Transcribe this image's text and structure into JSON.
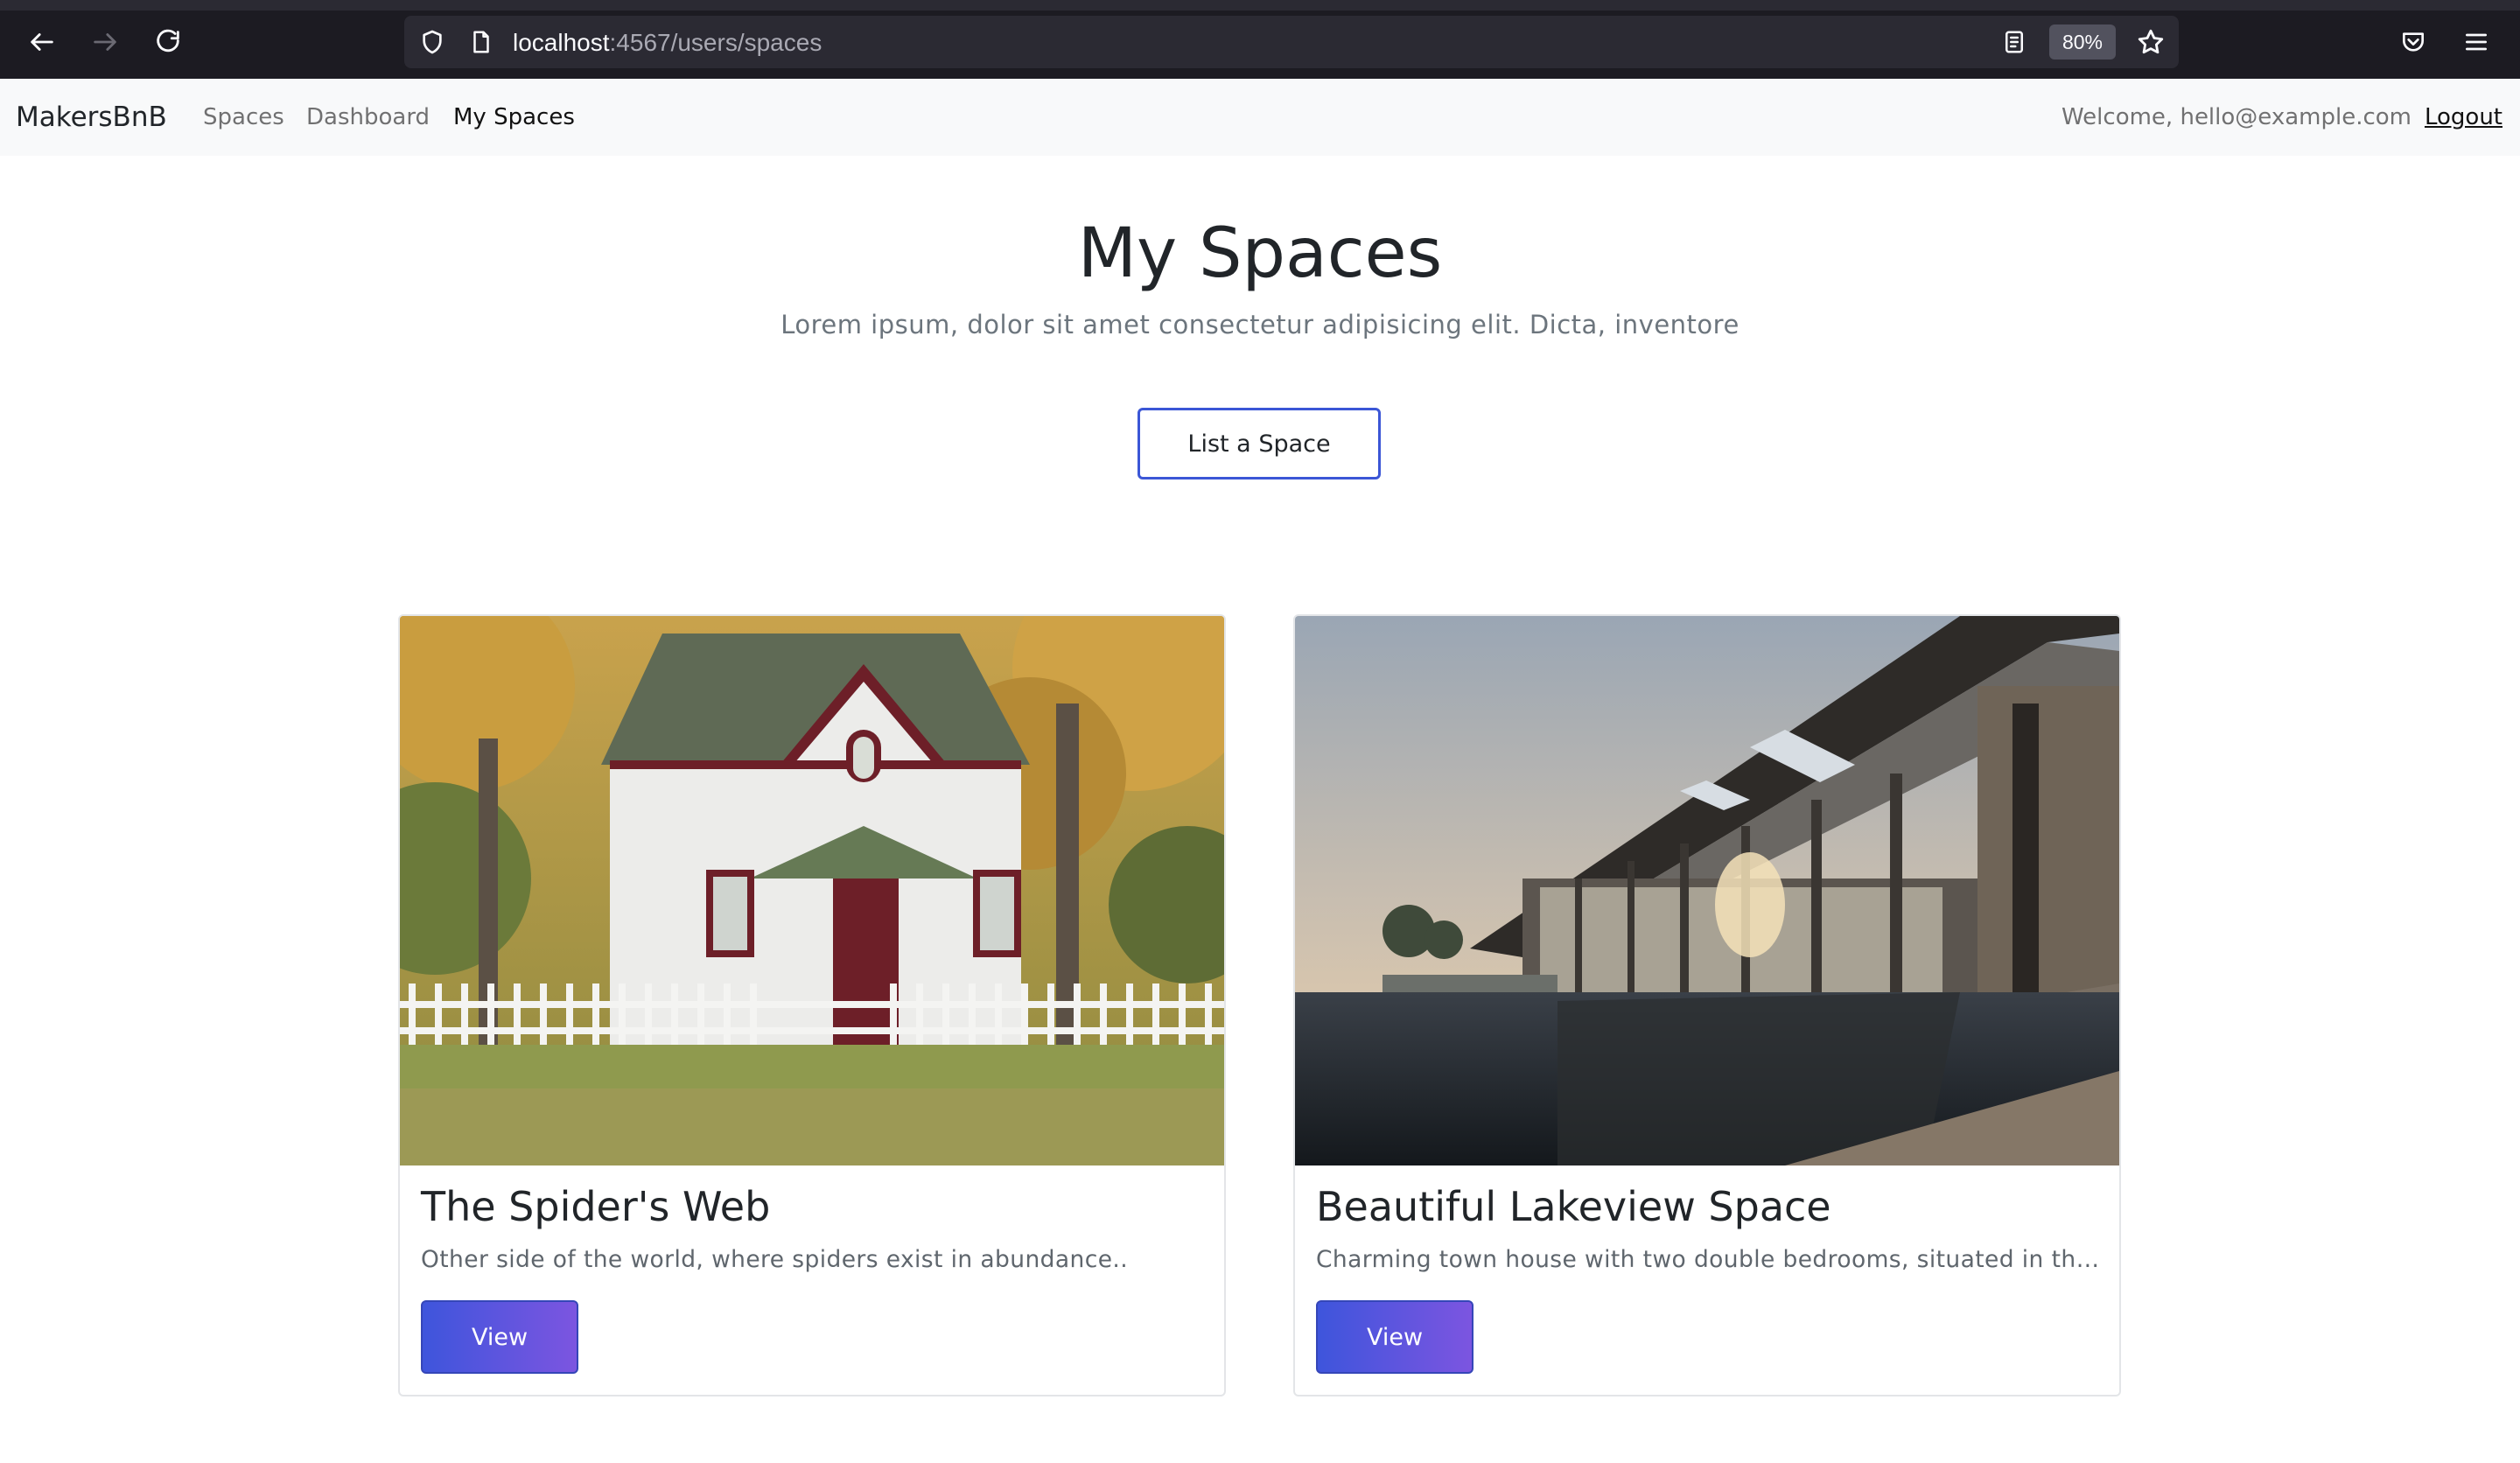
{
  "browser": {
    "url_host": "localhost",
    "url_rest": ":4567/users/spaces",
    "zoom": "80%",
    "icons": [
      "back-arrow-icon",
      "forward-arrow-icon",
      "reload-icon",
      "shield-icon",
      "page-icon",
      "reader-view-icon",
      "bookmark-star-icon",
      "pocket-icon",
      "hamburger-menu-icon"
    ]
  },
  "navbar": {
    "brand": "MakersBnB",
    "links": [
      {
        "label": "Spaces"
      },
      {
        "label": "Dashboard"
      },
      {
        "label": "My Spaces"
      }
    ],
    "welcome": "Welcome, hello@example.com",
    "logout": "Logout"
  },
  "hero": {
    "title": "My Spaces",
    "lead": "Lorem ipsum, dolor sit amet consectetur adipisicing elit. Dicta, inventore",
    "button": "List a Space"
  },
  "cards": [
    {
      "title": "The Spider's Web",
      "text": "Other side of the world, where spiders exist in abundance..",
      "button": "View"
    },
    {
      "title": "Beautiful Lakeview Space",
      "text": "Charming town house with two double bedrooms, situated in the heart of town",
      "button": "View"
    }
  ],
  "colors": {
    "accent_border": "#3b56d6",
    "button_gradient_start": "#3e55dc",
    "button_gradient_end": "#7c55e0",
    "navbar_bg": "#f8f9fa",
    "chrome_bg": "#1c1b22"
  }
}
